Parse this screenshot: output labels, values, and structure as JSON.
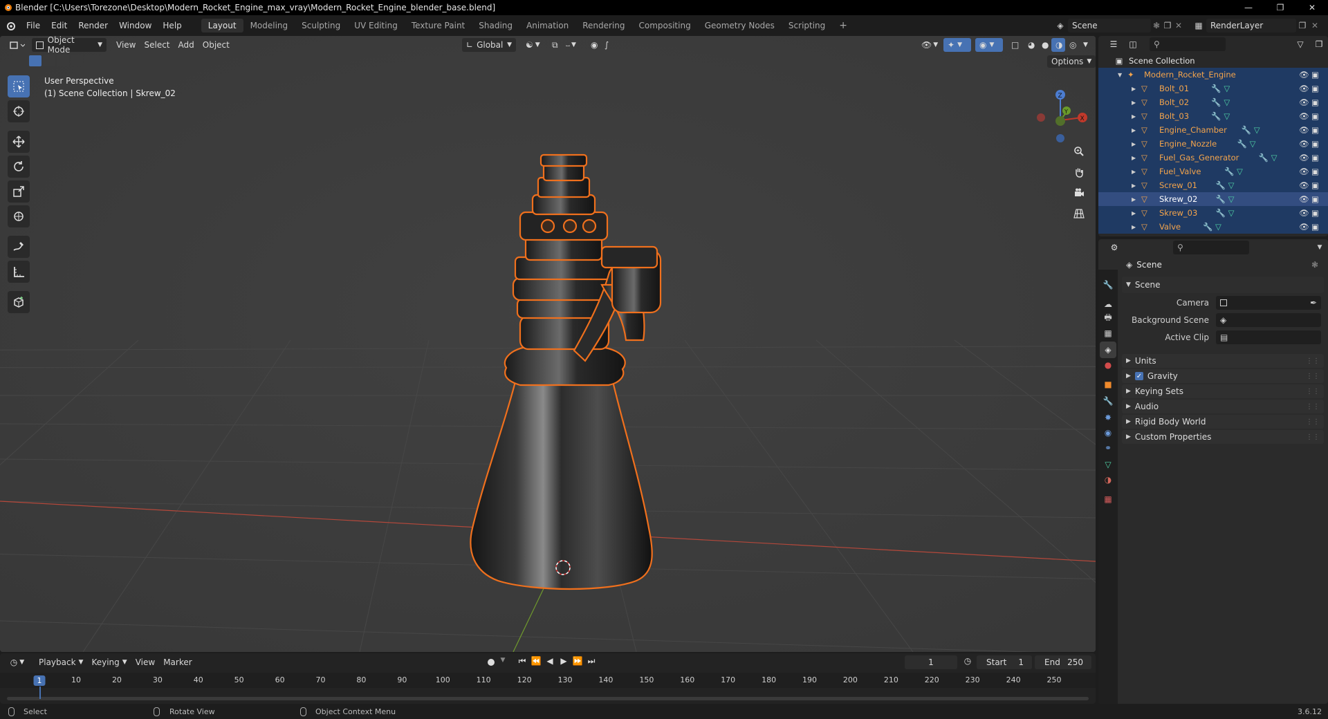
{
  "window": {
    "title": "Blender [C:\\Users\\Torezone\\Desktop\\Modern_Rocket_Engine_max_vray\\Modern_Rocket_Engine_blender_base.blend]"
  },
  "menu": [
    "File",
    "Edit",
    "Render",
    "Window",
    "Help"
  ],
  "workspaces": [
    "Layout",
    "Modeling",
    "Sculpting",
    "UV Editing",
    "Texture Paint",
    "Shading",
    "Animation",
    "Rendering",
    "Compositing",
    "Geometry Nodes",
    "Scripting"
  ],
  "active_workspace": "Layout",
  "scene_name": "Scene",
  "view_layer": "RenderLayer",
  "viewport": {
    "mode": "Object Mode",
    "menus": [
      "View",
      "Select",
      "Add",
      "Object"
    ],
    "transform_orientation": "Global",
    "options_label": "Options",
    "overlay_title": "User Perspective",
    "overlay_subtitle": "(1) Scene Collection | Skrew_02",
    "gizmo_x": "X",
    "gizmo_y": "Y",
    "gizmo_z": "Z"
  },
  "outliner": {
    "root": "Scene Collection",
    "collection": "Modern_Rocket_Engine",
    "items": [
      "Bolt_01",
      "Bolt_02",
      "Bolt_03",
      "Engine_Chamber",
      "Engine_Nozzle",
      "Fuel_Gas_Generator",
      "Fuel_Valve",
      "Screw_01",
      "Skrew_02",
      "Skrew_03",
      "Valve"
    ],
    "selected": "Skrew_02"
  },
  "properties": {
    "header": "Scene",
    "section": "Scene",
    "camera_label": "Camera",
    "background_scene_label": "Background Scene",
    "active_clip_label": "Active Clip",
    "panels": [
      "Units",
      "Gravity",
      "Keying Sets",
      "Audio",
      "Rigid Body World",
      "Custom Properties"
    ],
    "gravity_checked": true
  },
  "timeline": {
    "menus": [
      "Playback",
      "Keying",
      "View",
      "Marker"
    ],
    "current_frame": "1",
    "start_label": "Start",
    "start": "1",
    "end_label": "End",
    "end": "250",
    "ticks": [
      "1",
      "10",
      "20",
      "30",
      "40",
      "50",
      "60",
      "70",
      "80",
      "90",
      "100",
      "110",
      "120",
      "130",
      "140",
      "150",
      "160",
      "170",
      "180",
      "190",
      "200",
      "210",
      "220",
      "230",
      "240",
      "250"
    ]
  },
  "statusbar": {
    "select": "Select",
    "rotate": "Rotate View",
    "context": "Object Context Menu",
    "version": "3.6.12"
  },
  "colors": {
    "accent": "#4772b3",
    "selection_outline": "#f0701d",
    "outliner_text": "#f3a44c",
    "x_axis": "#c0392b",
    "y_axis": "#6a9a2a"
  }
}
